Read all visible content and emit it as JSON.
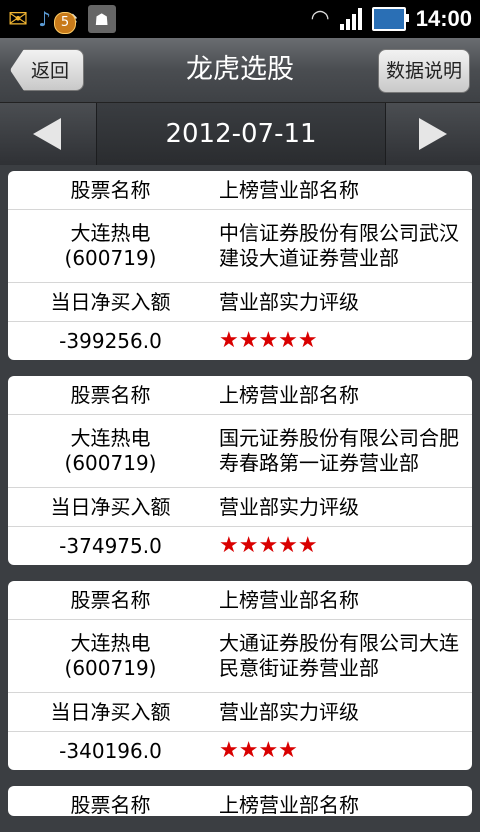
{
  "status_bar": {
    "time": "14:00",
    "badge": "5"
  },
  "header": {
    "title": "龙虎选股",
    "back_label": "返回",
    "explain_label": "数据说明"
  },
  "date_nav": {
    "date": "2012-07-11"
  },
  "labels": {
    "stock_name": "股票名称",
    "department_name": "上榜营业部名称",
    "net_buy": "当日净买入额",
    "rating": "营业部实力评级"
  },
  "records": [
    {
      "stock": "大连热电",
      "code": "(600719)",
      "department_line1": "中信证券股份有限公司武汉",
      "department_line2": "建设大道证券营业部",
      "net_buy": "-399256.0",
      "stars": "★★★★★"
    },
    {
      "stock": "大连热电",
      "code": "(600719)",
      "department_line1": "国元证券股份有限公司合肥",
      "department_line2": "寿春路第一证券营业部",
      "net_buy": "-374975.0",
      "stars": "★★★★★"
    },
    {
      "stock": "大连热电",
      "code": "(600719)",
      "department_line1": "大通证券股份有限公司大连",
      "department_line2": "民意街证券营业部",
      "net_buy": "-340196.0",
      "stars": "★★★★"
    }
  ],
  "icons": {
    "mail": "envelope-icon",
    "wifi": "wifi-icon",
    "usb": "usb-icon",
    "android": "android-icon",
    "signal": "signal-icon",
    "battery": "battery-icon",
    "prev": "arrow-left-icon",
    "next": "arrow-right-icon"
  },
  "colors": {
    "star": "#d90000",
    "title_bar": "#4a4d51",
    "background": "#3b3e42"
  }
}
